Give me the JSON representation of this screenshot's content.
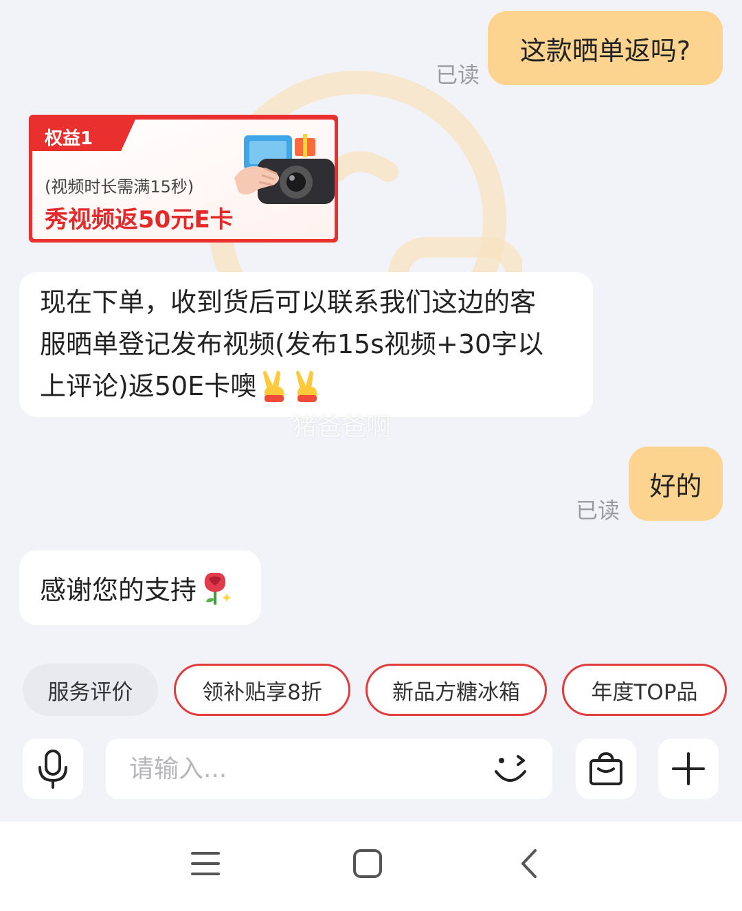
{
  "conversation": {
    "msg1": {
      "text": "这款晒单返吗?",
      "receipt": "已读"
    },
    "promo": {
      "tag": "权益1",
      "note": "(视频时长需满15秒)",
      "headline": "秀视频返50元E卡"
    },
    "msg2": {
      "lines": [
        "现在下单，收到货后可以联系我们这边的客",
        "服晒单登记发布视频(发布15s视频+30字以",
        "上评论)返50E卡噢"
      ],
      "emoji": "victory-hand-emoji"
    },
    "msg3": {
      "text": "好的",
      "receipt": "已读"
    },
    "msg4": {
      "text": "感谢您的支持",
      "emoji": "rose-emoji"
    }
  },
  "watermark": "猪爸爸啊",
  "quick_replies": [
    "服务评价",
    "领补贴享8折",
    "新品方糖冰箱",
    "年度TOP品"
  ],
  "input": {
    "placeholder": "请输入...",
    "value": "",
    "icons": [
      "microphone-icon",
      "emoji-wink-icon",
      "shopping-bag-icon",
      "plus-icon"
    ]
  },
  "nav": {
    "icons": [
      "menu-icon",
      "home-icon",
      "back-icon"
    ]
  },
  "colors": {
    "outgoing_bubble": "#fdd48f",
    "incoming_bubble": "#ffffff",
    "background": "#f2f3f8",
    "accent_red": "#e23b3b",
    "read_receipt": "#9a9aa0"
  }
}
